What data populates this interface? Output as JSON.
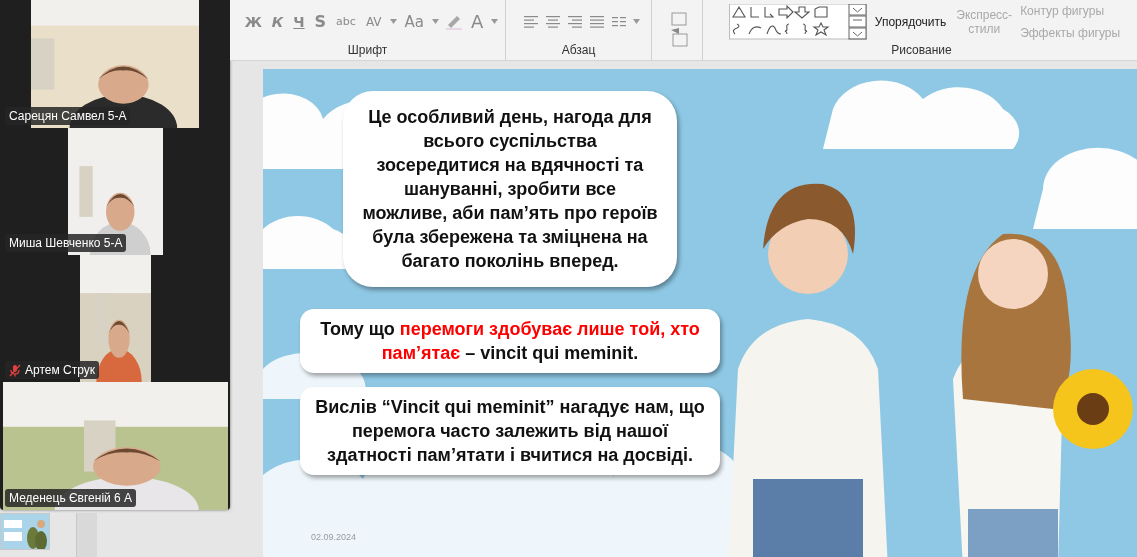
{
  "ribbon": {
    "font_group": {
      "label": "Шрифт",
      "buttons": [
        "Ж",
        "К",
        "Ч",
        "S",
        "abc",
        "AV",
        "Aa",
        "A"
      ]
    },
    "paragraph_group": {
      "label": "Абзац"
    },
    "drawing_group": {
      "label": "Рисование",
      "arrange": "Упорядочить",
      "quick_styles": {
        "lines": [
          "Экспресс-",
          "стили"
        ],
        "disabled": true
      },
      "commands": [
        {
          "label": "Контур фигуры",
          "disabled": true
        },
        {
          "label": "Эффекты фигуры",
          "disabled": true
        }
      ]
    }
  },
  "participants": [
    {
      "name": "Сарецян Самвел 5-А",
      "muted": false
    },
    {
      "name": "Миша Шевченко 5-А",
      "muted": false
    },
    {
      "name": "Артем Струк",
      "muted": true
    },
    {
      "name": "Меденець Євгеній 6 А",
      "muted": false
    }
  ],
  "slide": {
    "bubbles": [
      {
        "segments": [
          {
            "text": "Це особливий день, нагода для всього суспільства зосередитися на вдячності та шануванні, зробити все можливе, аби пам’ять про героїв була збережена та зміцнена на багато поколінь вперед.",
            "highlight": false
          }
        ]
      },
      {
        "segments": [
          {
            "text": "Тому що ",
            "highlight": false
          },
          {
            "text": "перемоги здобуває лише той, хто пам’ятає",
            "highlight": true
          },
          {
            "text": " – vincit qui meminit.",
            "highlight": false
          }
        ]
      },
      {
        "segments": [
          {
            "text": "Вислів “Vincit qui meminit” нагадує нам, що перемога часто залежить від нашої здатності пам’ятати і вчитися на досвіді.",
            "highlight": false
          }
        ]
      }
    ],
    "date": "02.09.2024"
  }
}
